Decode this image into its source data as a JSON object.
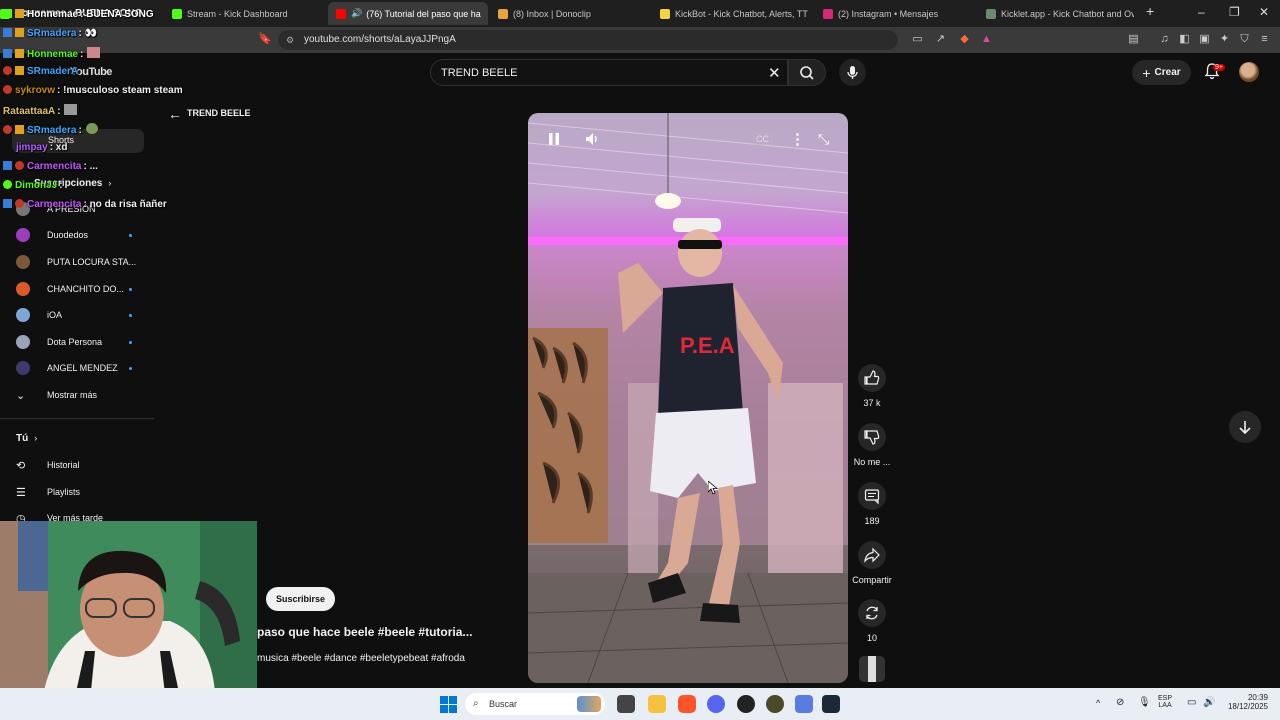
{
  "browser": {
    "tabs": [
      {
        "label": "Honnemae : BUENA SONG",
        "color": "#53fc18"
      },
      {
        "label": "Stream - Kick Dashboard",
        "color": "#53fc18"
      },
      {
        "label": "(76) Tutorial del paso que ha",
        "color": "#ff0000",
        "active": true
      },
      {
        "label": "(8) Inbox | Donoclip",
        "color": "#e8a33c"
      },
      {
        "label": "KickBot - Kick Chatbot, Alerts, TTS, C",
        "color": "#f5d442"
      },
      {
        "label": "(2) Instagram • Mensajes",
        "color": "#d62976"
      },
      {
        "label": "Kicklet.app - Kick Chatbot and Overl",
        "color": "#6c8a6c"
      }
    ],
    "new_tab": "+",
    "url": "youtube.com/shorts/aLayaJJPngA",
    "window_controls": [
      "–",
      "❐",
      "✕"
    ]
  },
  "youtube": {
    "search_query": "TREND BEELE",
    "create_label": "Crear",
    "notifications_badge": "9+",
    "back_title": "TREND BEELE"
  },
  "sidebar": {
    "logo": "YouTube",
    "shorts": "Shorts",
    "subscriptions": "Suscripciones",
    "channels": [
      {
        "name": "A PRESIÓN",
        "color": "#777"
      },
      {
        "name": "Duodedos",
        "color": "#9b3dbd"
      },
      {
        "name": "PUTA LOCURA STA...",
        "color": "#7a5a3a"
      },
      {
        "name": "CHANCHITO DO...",
        "color": "#d9592b"
      },
      {
        "name": "iOA",
        "color": "#7ea7d8"
      },
      {
        "name": "Dota Persona",
        "color": "#9aa3b8"
      },
      {
        "name": "ANGEL MENDEZ",
        "color": "#3b3b6e"
      }
    ],
    "show_more": "Mostrar más",
    "you": "Tú",
    "history": "Historial",
    "playlists": "Playlists",
    "watch_later": "Ver más tarde"
  },
  "chat": [
    {
      "user": "Honnemae",
      "text": ": BUENA SONG",
      "color": "#ffffff"
    },
    {
      "user": "SRmadera",
      "text": ": 👀",
      "color": "#3ea6ff"
    },
    {
      "user": "Honnemae",
      "text": ":",
      "color": "#53fc18"
    },
    {
      "user": "SRmaderA",
      "text": "",
      "color": "#3ea6ff"
    },
    {
      "user": "sykrovw",
      "text": ": !musculoso steam steam",
      "color": "#c98b00"
    },
    {
      "user": "RataattaaA",
      "text": ":",
      "color": "#e0c26a"
    },
    {
      "user": "SRmadera",
      "text": ":",
      "color": "#3ea6ff"
    },
    {
      "user": "jimpay",
      "text": ": xd",
      "color": "#b05cff"
    },
    {
      "user": "Carmencita",
      "text": ": ...",
      "color": "#c653ff"
    },
    {
      "user": "DimonJJ",
      "text": ":",
      "color": "#53fc18"
    },
    {
      "user": "Carmencita",
      "text": ": no da risa ñañer",
      "color": "#c653ff"
    }
  ],
  "short": {
    "subscribe_label": "Suscribirse",
    "title": "paso que hace beele #beele #tutoria...",
    "hashtags": "musica #beele #dance #beeletypebeat #afroda",
    "shirt_text": "P.E.A"
  },
  "actions": {
    "likes": "37 k",
    "dislike": "No me ...",
    "comments": "189",
    "share": "Compartir",
    "remix": "10"
  },
  "taskbar": {
    "search": "Buscar",
    "lang_top": "ESP",
    "lang_bottom": "LAA",
    "time": "20:39",
    "date": "18/12/2025"
  }
}
